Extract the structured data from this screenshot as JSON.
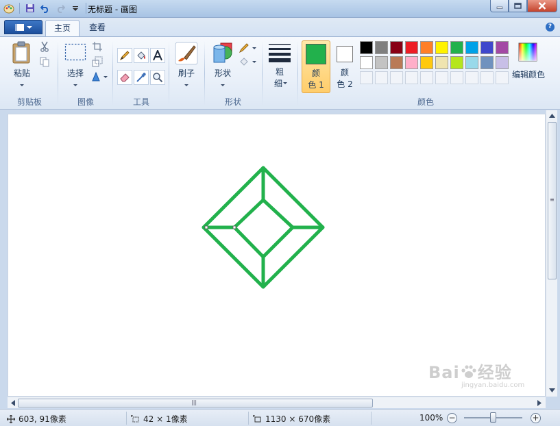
{
  "window": {
    "title": "无标题 - 画图"
  },
  "tabs": {
    "home": "主页",
    "view": "查看"
  },
  "groups": {
    "clipboard": "剪贴板",
    "image": "图像",
    "tools": "工具",
    "shapes": "形状",
    "colors": "颜色"
  },
  "buttons": {
    "paste": "粘贴",
    "select": "选择",
    "brush": "刷子",
    "shape": "形状",
    "size_line1": "粗",
    "size_line2": "细",
    "color1_line1": "颜",
    "color1_line2": "色 1",
    "color2_line1": "颜",
    "color2_line2": "色 2",
    "edit_colors": "编辑颜色"
  },
  "colors": {
    "active_color1": "#22b14c",
    "active_color2": "#ffffff",
    "palette_row1": [
      "#000000",
      "#7f7f7f",
      "#880015",
      "#ed1c24",
      "#ff7f27",
      "#fff200",
      "#22b14c",
      "#00a2e8",
      "#3f48cc",
      "#a349a4"
    ],
    "palette_row2": [
      "#ffffff",
      "#c3c3c3",
      "#b97a57",
      "#ffaec9",
      "#ffc90e",
      "#efe4b0",
      "#b5e61d",
      "#99d9ea",
      "#7092be",
      "#c8bfe7"
    ],
    "drawing_stroke": "#22b14c"
  },
  "status": {
    "cursor_pos": "603, 91像素",
    "selection_size": "42 × 1像素",
    "image_size": "1130 × 670像素",
    "zoom": "100%",
    "zoom_level": 1.0
  },
  "watermark": {
    "brand": "Bai",
    "brand_suffix": "经验",
    "url": "jingyan.baidu.com"
  }
}
